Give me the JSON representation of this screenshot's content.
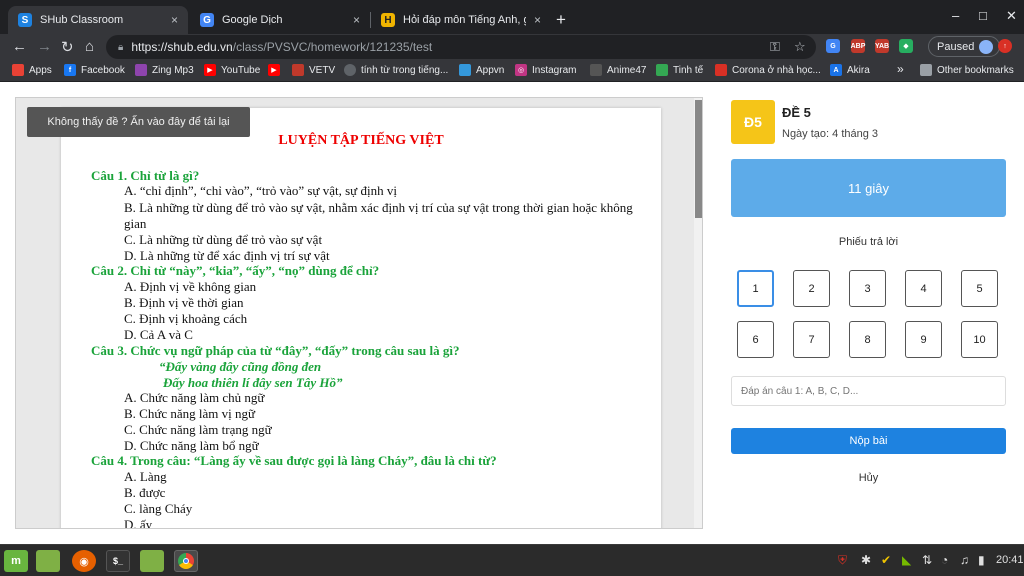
{
  "browser": {
    "tabs": [
      {
        "title": "SHub Classroom",
        "close": "×",
        "active": true
      },
      {
        "title": "Google Dịch",
        "close": "×",
        "active": false
      },
      {
        "title": "Hỏi đáp môn Tiếng Anh, giải bà",
        "close": "×",
        "active": false
      }
    ],
    "new_tab": "+",
    "window_controls": {
      "minimize": "–",
      "maximize": "□",
      "close": "✕"
    },
    "nav": {
      "back": "←",
      "forward": "→",
      "reload": "↻",
      "home": "⌂"
    },
    "url_prefix": "https://shub.edu.vn",
    "url_rest": "/class/PVSVC/homework/121235/test",
    "profile_label": "Paused",
    "bookmarks": [
      {
        "label": "Apps",
        "color": "#e94235"
      },
      {
        "label": "Facebook",
        "color": "#1877f2"
      },
      {
        "label": "Zing Mp3",
        "color": "#8e44ad"
      },
      {
        "label": "YouTube",
        "color": "#ff0000"
      },
      {
        "label": "",
        "color": "#ff0000"
      },
      {
        "label": "VETV",
        "color": "#c0392b"
      },
      {
        "label": "tính từ trong tiếng...",
        "color": "#5f6368"
      },
      {
        "label": "Appvn",
        "color": "#3498db"
      },
      {
        "label": "Instagram",
        "color": "#c13584"
      },
      {
        "label": "Anime47",
        "color": "#555555"
      },
      {
        "label": "Tinh tế",
        "color": "#34a853"
      },
      {
        "label": "Corona ở nhà học...",
        "color": "#d93025"
      },
      {
        "label": "Akira",
        "color": "#1a73e8"
      },
      {
        "label": "»",
        "color": ""
      },
      {
        "label": "Other bookmarks",
        "color": "#9aa0a6"
      }
    ]
  },
  "viewer": {
    "reload_hint": "Không thấy đề ? Ấn vào đây để tải lại",
    "doc_title": "LUYỆN TẬP TIẾNG VIỆT",
    "questions": [
      {
        "q": "Câu 1. Chỉ từ là gì?",
        "options": [
          "A. “chỉ định”, “chỉ vào”, “trỏ vào” sự vật, sự định vị",
          "B. Là những từ dùng để trỏ vào sự vật, nhằm xác định vị trí của sự vật trong thời gian hoặc không gian",
          "C. Là những từ dùng để trỏ vào sự vật",
          "D. Là những từ để xác định vị trí sự vật"
        ]
      },
      {
        "q": "Câu 2. Chỉ từ “này”, “kia”, “ấy”, “nọ” dùng để chỉ?",
        "options": [
          "A. Định vị về không gian",
          "B. Định vị về thời gian",
          "C. Định vị khoảng cách",
          "D. Cả A và C"
        ]
      },
      {
        "q": "Câu 3. Chức vụ ngữ pháp của từ “đây”, “đấy” trong câu sau là gì?",
        "quote": [
          "“Đấy vàng đây cũng đồng đen",
          "Đấy hoa thiên lí đây sen Tây Hồ”"
        ],
        "options": [
          "A. Chức năng làm chủ ngữ",
          "B. Chức năng làm vị ngữ",
          "C. Chức năng làm trạng ngữ",
          "D. Chức năng làm bổ ngữ"
        ]
      },
      {
        "q": "Câu 4. Trong câu: “Làng ấy về sau được gọi là làng Cháy”, đâu là chỉ từ?",
        "options": [
          "A. Làng",
          "B. được",
          "C. làng Cháy",
          "D. ấy"
        ]
      }
    ]
  },
  "sidebar": {
    "badge": "Đ5",
    "title": "ĐỀ 5",
    "created": "Ngày tạo: 4 tháng 3",
    "timer": "11 giây",
    "sheet_label": "Phiếu trả lời",
    "numbers": [
      "1",
      "2",
      "3",
      "4",
      "5",
      "6",
      "7",
      "8",
      "9",
      "10"
    ],
    "selected": "1",
    "answer_placeholder": "Đáp án câu 1: A, B, C, D...",
    "submit": "Nộp bài",
    "cancel": "Hủy"
  },
  "taskbar": {
    "clock": "20:41",
    "apps": [
      {
        "name": "menu",
        "color": "#69b53f",
        "glyph": "m"
      },
      {
        "name": "files",
        "color": "#7fb045",
        "glyph": ""
      },
      {
        "name": "firefox",
        "color": "#e66000",
        "glyph": "◉"
      },
      {
        "name": "terminal",
        "color": "#333333",
        "glyph": "$_"
      },
      {
        "name": "folder",
        "color": "#7fb045",
        "glyph": ""
      },
      {
        "name": "chrome",
        "color": "#4285f4",
        "glyph": "◎"
      }
    ]
  }
}
